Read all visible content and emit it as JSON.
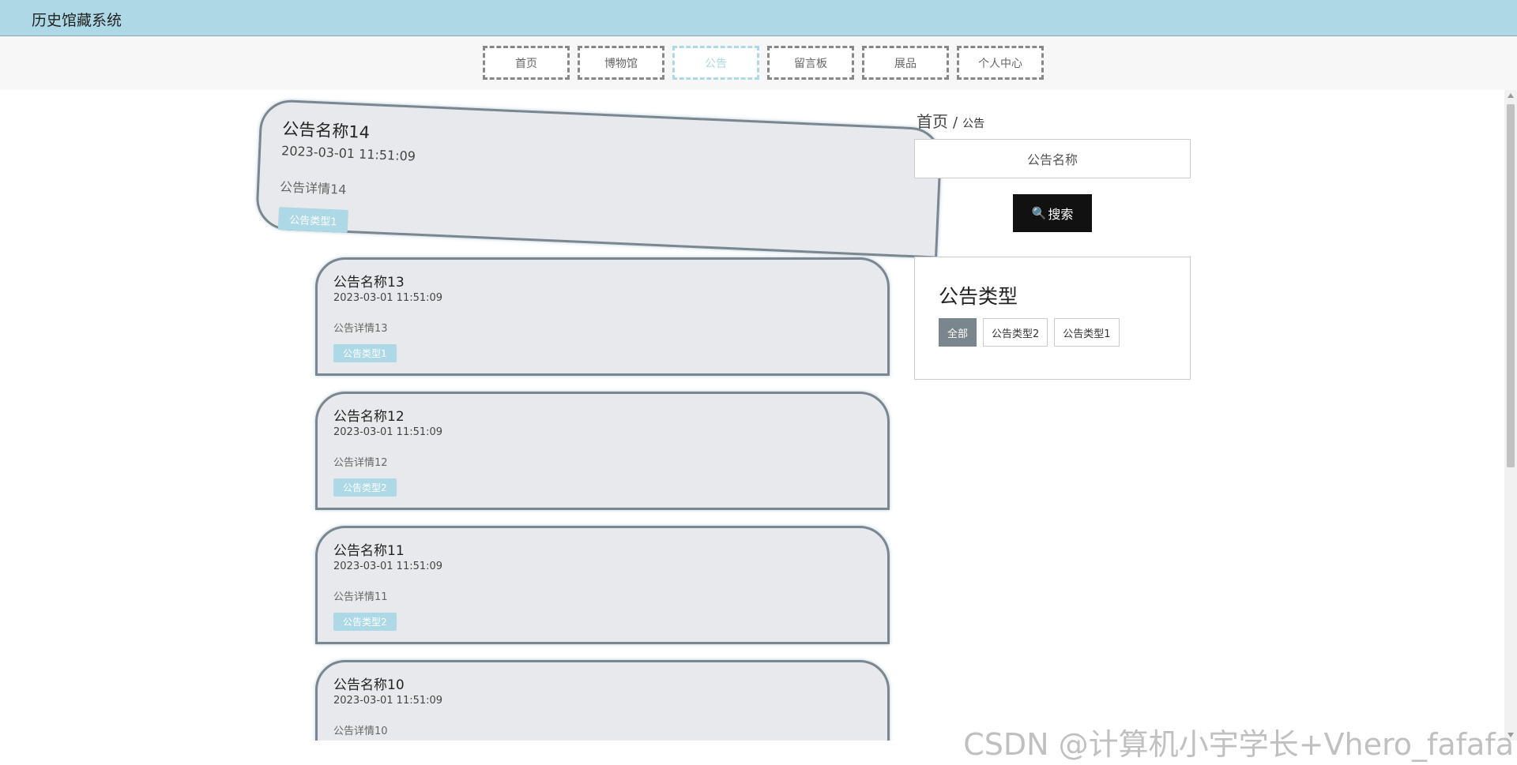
{
  "header": {
    "site_title": "历史馆藏系统"
  },
  "nav": {
    "items": [
      {
        "label": "首页",
        "active": false
      },
      {
        "label": "博物馆",
        "active": false
      },
      {
        "label": "公告",
        "active": true
      },
      {
        "label": "留言板",
        "active": false
      },
      {
        "label": "展品",
        "active": false
      },
      {
        "label": "个人中心",
        "active": false
      }
    ]
  },
  "notices": [
    {
      "title": "公告名称14",
      "time": "2023-03-01 11:51:09",
      "detail": "公告详情14",
      "type": "公告类型1"
    },
    {
      "title": "公告名称13",
      "time": "2023-03-01 11:51:09",
      "detail": "公告详情13",
      "type": "公告类型1"
    },
    {
      "title": "公告名称12",
      "time": "2023-03-01 11:51:09",
      "detail": "公告详情12",
      "type": "公告类型2"
    },
    {
      "title": "公告名称11",
      "time": "2023-03-01 11:51:09",
      "detail": "公告详情11",
      "type": "公告类型2"
    },
    {
      "title": "公告名称10",
      "time": "2023-03-01 11:51:09",
      "detail": "公告详情10",
      "type": ""
    }
  ],
  "breadcrumb": {
    "home": "首页",
    "separator": "/",
    "current": "公告"
  },
  "search": {
    "placeholder": "公告名称",
    "button_label": "搜索"
  },
  "type_panel": {
    "title": "公告类型",
    "options": [
      {
        "label": "全部",
        "active": true
      },
      {
        "label": "公告类型2",
        "active": false
      },
      {
        "label": "公告类型1",
        "active": false
      }
    ]
  },
  "watermark": "CSDN @计算机小宇学长+Vhero_fafafa",
  "colors": {
    "accent": "#add8e6",
    "card_bg": "#e8e9ec",
    "card_border": "#7b8790",
    "button_dark": "#111111",
    "active_type": "#7a868d"
  }
}
